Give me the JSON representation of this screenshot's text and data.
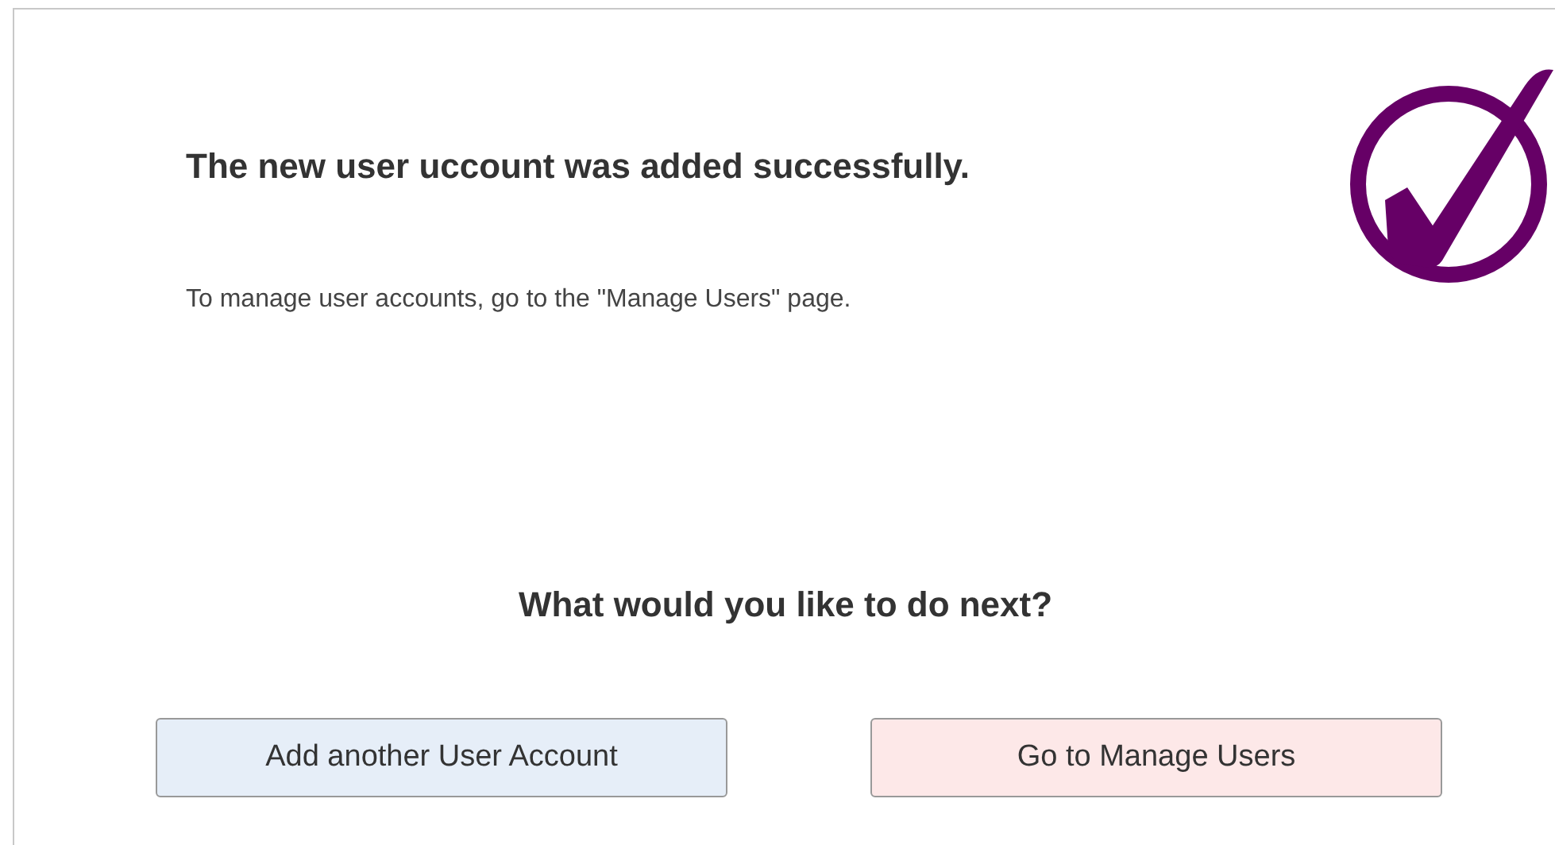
{
  "message": {
    "title": "The new user uccount was added successfully.",
    "text": "To manage user accounts, go to the \"Manage Users\" page."
  },
  "next": {
    "question": "What would you like to do next?",
    "buttons": [
      {
        "label": "Add another User Account",
        "color": "#e6eef8"
      },
      {
        "label": "Go to Manage Users",
        "color": "#fde8e8"
      }
    ]
  }
}
